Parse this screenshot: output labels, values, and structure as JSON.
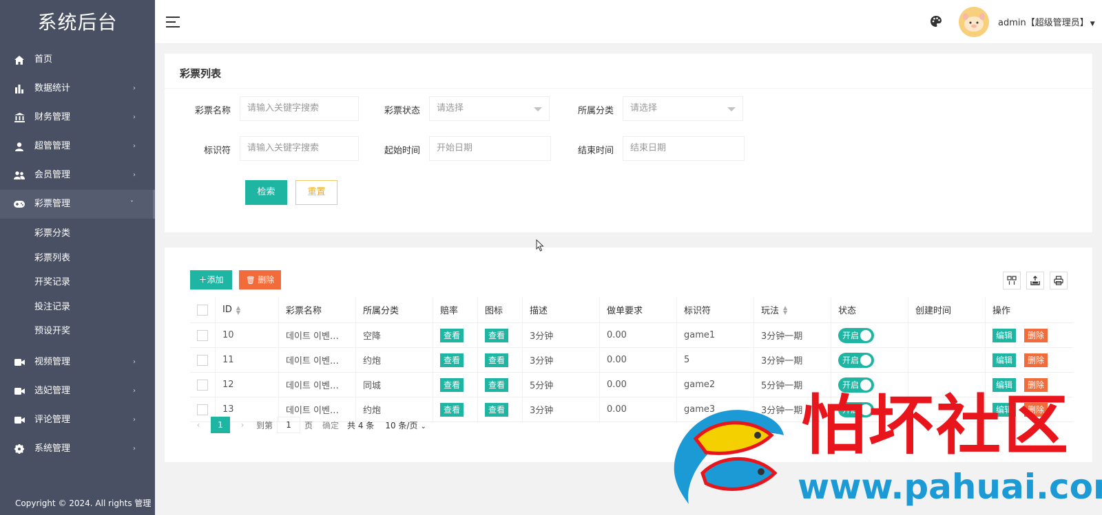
{
  "sidebar": {
    "logo": "系统后台",
    "items": [
      {
        "label": "首页"
      },
      {
        "label": "数据统计"
      },
      {
        "label": "财务管理"
      },
      {
        "label": "超管管理"
      },
      {
        "label": "会员管理"
      },
      {
        "label": "彩票管理"
      },
      {
        "label": "视频管理"
      },
      {
        "label": "选妃管理"
      },
      {
        "label": "评论管理"
      },
      {
        "label": "系统管理"
      }
    ],
    "sub_items": [
      {
        "label": "彩票分类"
      },
      {
        "label": "彩票列表"
      },
      {
        "label": "开奖记录"
      },
      {
        "label": "投注记录"
      },
      {
        "label": "预设开奖"
      }
    ],
    "copyright": "Copyright © 2024. All rights 管理"
  },
  "header": {
    "user_name": "admin【超级管理员】"
  },
  "search_card": {
    "title": "彩票列表",
    "name_label": "彩票名称",
    "name_placeholder": "请输入关键字搜索",
    "status_label": "彩票状态",
    "status_placeholder": "请选择",
    "category_label": "所属分类",
    "category_placeholder": "请选择",
    "key_label": "标识符",
    "key_placeholder": "请输入关键字搜索",
    "start_label": "起始时间",
    "start_placeholder": "开始日期",
    "end_label": "结束时间",
    "end_placeholder": "结束日期",
    "search_button": "检索",
    "reset_button": "重置"
  },
  "toolbar": {
    "add_label": "添加",
    "delete_label": "删除"
  },
  "table": {
    "columns": [
      "ID",
      "彩票名称",
      "所属分类",
      "赔率",
      "图标",
      "描述",
      "做单要求",
      "标识符",
      "玩法",
      "状态",
      "创建时间",
      "操作"
    ],
    "view_label": "查看",
    "switch_label": "开启",
    "edit_label": "编辑",
    "row_delete_label": "删除",
    "rows": [
      {
        "id": "10",
        "name": "데이트 이벤…",
        "category": "空降",
        "desc": "3分钟",
        "req": "0.00",
        "key": "game1",
        "play": "3分钟一期",
        "created": ""
      },
      {
        "id": "11",
        "name": "데이트 이벤…",
        "category": "约炮",
        "desc": "3分钟",
        "req": "0.00",
        "key": "5",
        "play": "3分钟一期",
        "created": ""
      },
      {
        "id": "12",
        "name": "데이트 이벤…",
        "category": "同城",
        "desc": "5分钟",
        "req": "0.00",
        "key": "game2",
        "play": "5分钟一期",
        "created": ""
      },
      {
        "id": "13",
        "name": "데이트 이벤…",
        "category": "约炮",
        "desc": "3分钟",
        "req": "0.00",
        "key": "game3",
        "play": "3分钟一期",
        "created": ""
      }
    ]
  },
  "pagination": {
    "current_page": "1",
    "goto_label": "到第",
    "goto_value": "1",
    "page_unit": "页",
    "confirm_label": "确定",
    "total": "共 4 条",
    "page_size": "10 条/页"
  },
  "watermark": {
    "title": "怕坏社区",
    "url": "www.pahuai.com"
  },
  "colors": {
    "sidebar_bg": "#4a5064",
    "primary": "#1fb5a3",
    "danger": "#f26b3a",
    "warning": "#f0ad2c",
    "watermark_red": "#e8161c",
    "watermark_blue": "#1c9ad6"
  }
}
